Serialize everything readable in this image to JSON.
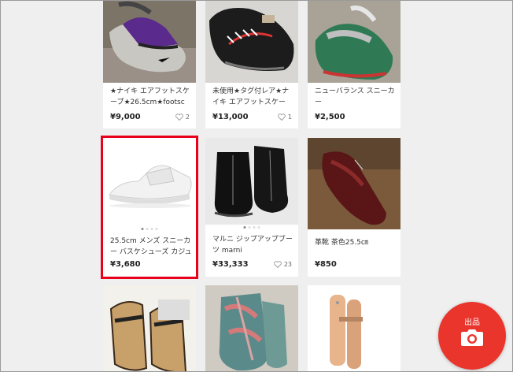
{
  "items": [
    {
      "title": "★ナイキ エアフットスケープ★26.5cm★footsc",
      "price": "¥9,000",
      "likes": "2"
    },
    {
      "title": "未使用★タグ付レア★ナイキ エアフットスケー",
      "price": "¥13,000",
      "likes": "1"
    },
    {
      "title": "ニューバランス スニーカー",
      "price": "¥2,500",
      "likes": ""
    },
    {
      "title": "25.5cm メンズ スニーカー バスケシューズ カジュ",
      "price": "¥3,680",
      "likes": ""
    },
    {
      "title": "マルニ ジップアップブーツ marni",
      "price": "¥33,333",
      "likes": "23"
    },
    {
      "title": "革靴 茶色25.5㎝",
      "price": "¥850",
      "likes": ""
    }
  ],
  "sell_button": {
    "label": "出品",
    "icon": "camera-icon"
  },
  "colors": {
    "accent": "#ea352d",
    "selection": "#e8001c"
  }
}
